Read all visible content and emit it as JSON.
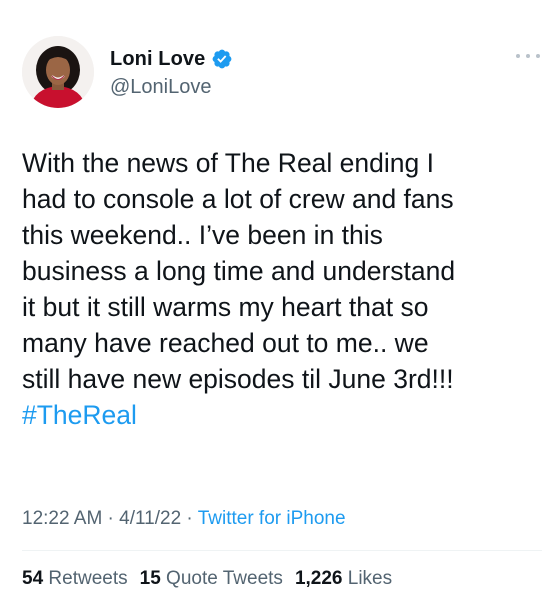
{
  "author": {
    "display_name": "Loni Love",
    "handle": "@LoniLove",
    "verified": true,
    "verified_color": "#1d9bf0"
  },
  "tweet": {
    "text": "With the news of The Real ending I\nhad to console a lot of crew and fans\nthis weekend.. I’ve been in this\nbusiness a long time and understand\nit but it still warms my heart that so\nmany have reached out to me.. we\nstill have new episodes til June 3rd!!!",
    "hashtag": "#TheReal",
    "hashtag_color": "#1d9bf0"
  },
  "meta": {
    "time": "12:22 AM",
    "separator": " · ",
    "date": "4/11/22",
    "source": "Twitter for iPhone"
  },
  "stats": {
    "retweets_count": "54",
    "retweets_label": "Retweets",
    "quotes_count": "15",
    "quotes_label": "Quote Tweets",
    "likes_count": "1,226",
    "likes_label": "Likes"
  },
  "icons": {
    "avatar": "profile-photo",
    "verified": "verified-badge-icon",
    "more": "more-options-icon"
  }
}
